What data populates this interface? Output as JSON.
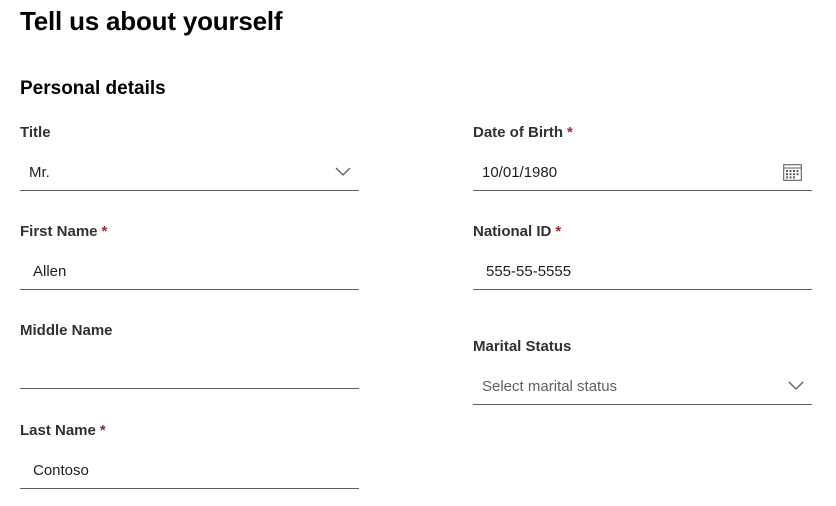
{
  "page": {
    "title": "Tell us about yourself"
  },
  "section": {
    "title": "Personal details"
  },
  "required_marker": "*",
  "fields": {
    "title": {
      "label": "Title",
      "value": "Mr.",
      "icon": "chevron-down-icon"
    },
    "first_name": {
      "label": "First Name",
      "value": "Allen",
      "required": true
    },
    "middle_name": {
      "label": "Middle Name",
      "value": ""
    },
    "last_name": {
      "label": "Last Name",
      "value": "Contoso",
      "required": true
    },
    "date_of_birth": {
      "label": "Date of Birth",
      "value": "10/01/1980",
      "required": true,
      "icon": "calendar-icon"
    },
    "national_id": {
      "label": "National ID",
      "value": "555-55-5555",
      "required": true
    },
    "marital_status": {
      "label": "Marital Status",
      "placeholder": "Select marital status",
      "icon": "chevron-down-icon"
    }
  },
  "colors": {
    "required": "#a4262c",
    "underline": "#605e5c",
    "text": "#201f1e"
  }
}
